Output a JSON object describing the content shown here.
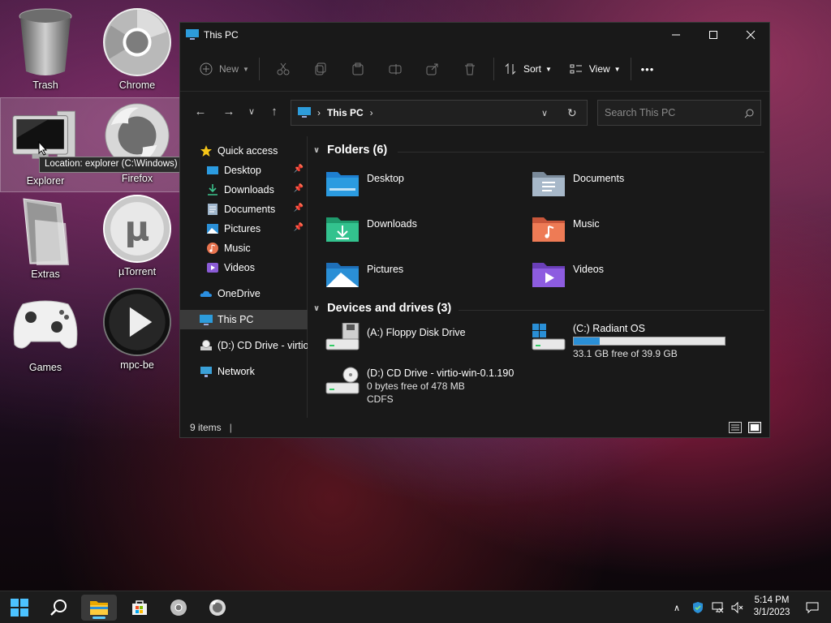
{
  "desktop": {
    "icons": [
      {
        "label": "Trash"
      },
      {
        "label": "Chrome"
      },
      {
        "label": "Explorer"
      },
      {
        "label": "Firefox"
      },
      {
        "label": "Extras"
      },
      {
        "label": "µTorrent"
      },
      {
        "label": "Games"
      },
      {
        "label": "mpc-be"
      }
    ],
    "tooltip": "Location: explorer (C:\\Windows)"
  },
  "window": {
    "title": "This PC",
    "toolbar": {
      "new_label": "New",
      "sort_label": "Sort",
      "view_label": "View",
      "more_label": "•••"
    },
    "address": {
      "path": "This PC",
      "separator": "›"
    },
    "search": {
      "placeholder": "Search This PC"
    },
    "sidebar": {
      "items": [
        {
          "label": "Quick access"
        },
        {
          "label": "Desktop"
        },
        {
          "label": "Downloads"
        },
        {
          "label": "Documents"
        },
        {
          "label": "Pictures"
        },
        {
          "label": "Music"
        },
        {
          "label": "Videos"
        },
        {
          "label": "OneDrive"
        },
        {
          "label": "This PC"
        },
        {
          "label": "(D:) CD Drive - virtio-win-0.1.190"
        },
        {
          "label": "Network"
        }
      ]
    },
    "content": {
      "folders_header": "Folders (6)",
      "folders": [
        {
          "label": "Desktop"
        },
        {
          "label": "Documents"
        },
        {
          "label": "Downloads"
        },
        {
          "label": "Music"
        },
        {
          "label": "Pictures"
        },
        {
          "label": "Videos"
        }
      ],
      "devices_header": "Devices and drives (3)",
      "drives": [
        {
          "label": "(A:) Floppy Disk Drive"
        },
        {
          "label": "(C:) Radiant OS",
          "free": "33.1 GB free of 39.9 GB",
          "used_fraction": 0.17
        },
        {
          "label": "(D:) CD Drive - virtio-win-0.1.190",
          "free": "0 bytes free of 478 MB",
          "fs": "CDFS"
        }
      ]
    },
    "status": {
      "items": "9 items"
    }
  },
  "taskbar": {
    "clock_time": "5:14 PM",
    "clock_date": "3/1/2023"
  },
  "colors": {
    "accent": "#60cdff",
    "drive_bar": "#2a8fd6",
    "window_bg": "#191919"
  }
}
